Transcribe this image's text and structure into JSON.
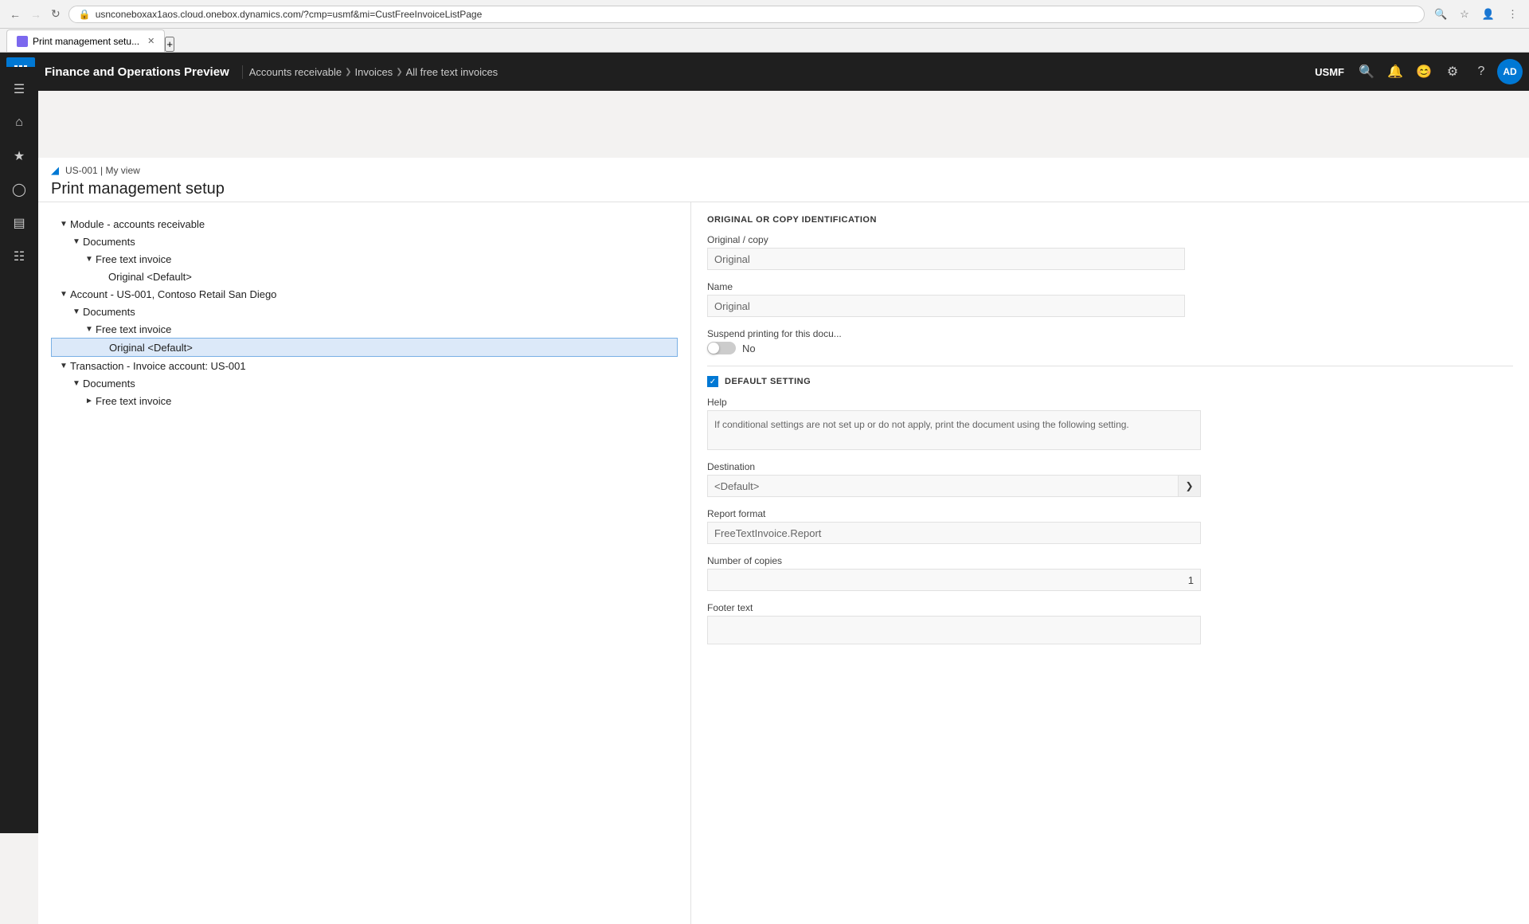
{
  "browser": {
    "tab_title": "Print management setu...",
    "url": "usnconeboxax1aos.cloud.onebox.dynamics.com/?cmp=usmf&mi=CustFreeInvoiceListPage",
    "new_tab_label": "+"
  },
  "top_nav": {
    "app_name": "Finance and Operations Preview",
    "breadcrumbs": [
      "Accounts receivable",
      "Invoices",
      "All free text invoices"
    ],
    "company": "USMF",
    "user_initials": "AD"
  },
  "page": {
    "filter_icon": "⚙",
    "view_label": "US-001  |  My view",
    "title": "Print management setup"
  },
  "tree": {
    "items": [
      {
        "id": 1,
        "indent": 1,
        "toggle": "▲",
        "label": "Module - accounts receivable",
        "selected": false
      },
      {
        "id": 2,
        "indent": 2,
        "toggle": "▲",
        "label": "Documents",
        "selected": false
      },
      {
        "id": 3,
        "indent": 3,
        "toggle": "▲",
        "label": "Free text invoice",
        "selected": false
      },
      {
        "id": 4,
        "indent": 4,
        "toggle": "",
        "label": "Original <Default>",
        "selected": false
      },
      {
        "id": 5,
        "indent": 1,
        "toggle": "▲",
        "label": "Account - US-001, Contoso Retail San Diego",
        "selected": false
      },
      {
        "id": 6,
        "indent": 2,
        "toggle": "▲",
        "label": "Documents",
        "selected": false
      },
      {
        "id": 7,
        "indent": 3,
        "toggle": "▲",
        "label": "Free text invoice",
        "selected": false
      },
      {
        "id": 8,
        "indent": 4,
        "toggle": "",
        "label": "Original <Default>",
        "selected": true
      },
      {
        "id": 9,
        "indent": 1,
        "toggle": "▲",
        "label": "Transaction - Invoice account: US-001",
        "selected": false
      },
      {
        "id": 10,
        "indent": 2,
        "toggle": "▲",
        "label": "Documents",
        "selected": false
      },
      {
        "id": 11,
        "indent": 3,
        "toggle": "▶",
        "label": "Free text invoice",
        "selected": false
      }
    ]
  },
  "right_panel": {
    "section_title": "ORIGINAL OR COPY IDENTIFICATION",
    "original_copy_label": "Original / copy",
    "original_copy_value": "Original",
    "name_label": "Name",
    "name_value": "Original",
    "suspend_label": "Suspend printing for this docu...",
    "suspend_toggle": "No",
    "default_section_title": "DEFAULT SETTING",
    "help_label": "Help",
    "help_text": "If conditional settings are not set up or do not apply, print the document using the following setting.",
    "destination_label": "Destination",
    "destination_value": "<Default>",
    "report_format_label": "Report format",
    "report_format_value": "FreeTextInvoice.Report",
    "copies_label": "Number of copies",
    "copies_value": "1",
    "footer_label": "Footer text"
  },
  "sidebar": {
    "buttons": [
      {
        "id": "menu",
        "icon": "≡",
        "label": "menu-icon"
      },
      {
        "id": "home",
        "icon": "⌂",
        "label": "home-icon"
      },
      {
        "id": "favorites",
        "icon": "★",
        "label": "favorites-icon"
      },
      {
        "id": "recent",
        "icon": "◷",
        "label": "recent-icon"
      },
      {
        "id": "workspaces",
        "icon": "▦",
        "label": "workspaces-icon"
      },
      {
        "id": "modules",
        "icon": "☰",
        "label": "modules-icon"
      }
    ]
  }
}
